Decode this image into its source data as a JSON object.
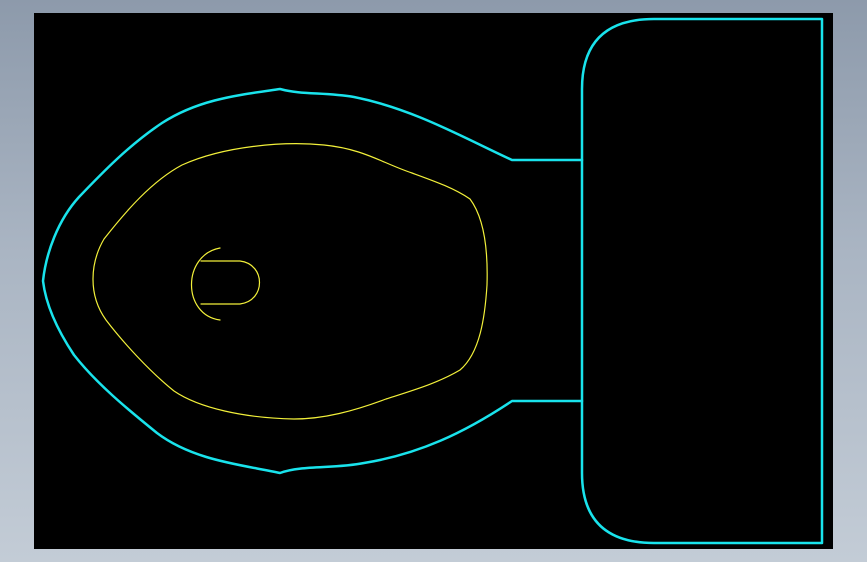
{
  "drawing": {
    "background_color": "#000000",
    "frame_color": "#9aa6b5",
    "outline_color": "#19e3ec",
    "bowl_color": "#f2f03a",
    "objects": {
      "tank": "toilet-tank-outline",
      "bowl_outer": "toilet-bowl-outer-rim",
      "bowl_inner": "toilet-bowl-inner-edge",
      "drain": "toilet-drain-symbol"
    }
  }
}
